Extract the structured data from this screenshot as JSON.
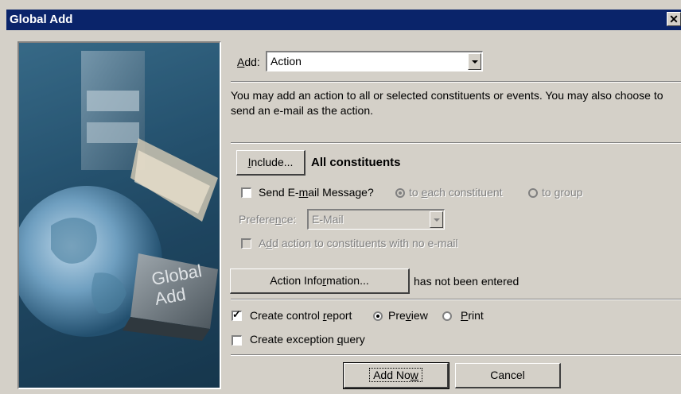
{
  "window": {
    "title": "Global Add",
    "close_glyph": "✕"
  },
  "art": {
    "key_text_line1": "Global",
    "key_text_line2": "Add"
  },
  "add": {
    "label_prefix": "A",
    "label_rest": "dd:",
    "value": "Action"
  },
  "description": "You may add an action to all or selected constituents or events.  You may also choose to send an e-mail as the action.",
  "include": {
    "button_prefix": "I",
    "button_rest": "nclude...",
    "status": "All constituents"
  },
  "send_email": {
    "label_a": "Send E-",
    "label_u": "m",
    "label_b": "ail Message?",
    "checked": false,
    "radio_each_a": "to ",
    "radio_each_u": "e",
    "radio_each_b": "ach constituent",
    "radio_group_a": "to ",
    "radio_group_u": "g",
    "radio_group_b": "roup",
    "selected": "each"
  },
  "preference": {
    "label_a": "Prefere",
    "label_u": "n",
    "label_b": "ce:",
    "value": "E-Mail"
  },
  "no_email": {
    "label_a": "A",
    "label_u": "d",
    "label_b": "d action to constituents with no e-mail",
    "checked": false
  },
  "action_info": {
    "button_a": "Action Info",
    "button_u": "r",
    "button_b": "mation...",
    "status": "has not been entered"
  },
  "control_report": {
    "checked": true,
    "label_a": "Create control ",
    "label_u": "r",
    "label_b": "eport",
    "preview_a": "Pre",
    "preview_u": "v",
    "preview_b": "iew",
    "print_u": "P",
    "print_b": "rint",
    "selected": "preview"
  },
  "exception_query": {
    "checked": false,
    "label_a": "Create exception ",
    "label_u": "q",
    "label_b": "uery"
  },
  "footer": {
    "add_now_a": "Add No",
    "add_now_u": "w",
    "cancel": "Cancel"
  },
  "colors": {
    "titlebar": "#0a246a",
    "face": "#d4d0c8"
  }
}
